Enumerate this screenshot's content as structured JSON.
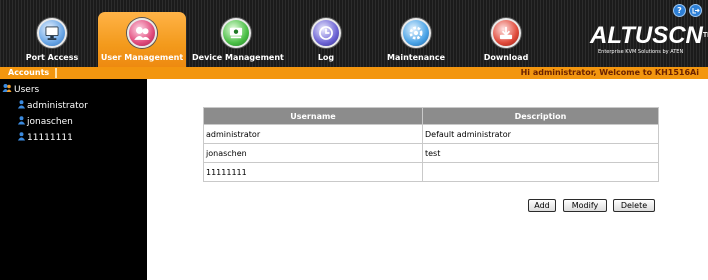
{
  "header": {
    "tabs": [
      {
        "label": "Port Access",
        "icon": "monitor-icon",
        "active": false
      },
      {
        "label": "User Management",
        "icon": "users-icon",
        "active": true
      },
      {
        "label": "Device Management",
        "icon": "device-icon",
        "active": false
      },
      {
        "label": "Log",
        "icon": "log-icon",
        "active": false
      },
      {
        "label": "Maintenance",
        "icon": "maintenance-icon",
        "active": false
      },
      {
        "label": "Download",
        "icon": "download-icon",
        "active": false
      }
    ],
    "help_icon": "?",
    "logout_icon": "logout-icon",
    "logo": {
      "brand": "ALTUSCN",
      "trademark": "TM",
      "tagline": "Enterprise KVM Solutions by ATEN"
    }
  },
  "subbar": {
    "section": "Accounts",
    "welcome": "Hi administrator, Welcome to KH1516Ai"
  },
  "sidebar": {
    "root": "Users",
    "users": [
      "administrator",
      "jonaschen",
      "11111111"
    ]
  },
  "table": {
    "headers": [
      "Username",
      "Description"
    ],
    "rows": [
      {
        "username": "administrator",
        "description": "Default administrator"
      },
      {
        "username": "jonaschen",
        "description": "test"
      },
      {
        "username": "11111111",
        "description": ""
      }
    ]
  },
  "buttons": {
    "add": "Add",
    "modify": "Modify",
    "delete": "Delete"
  },
  "colors": {
    "accent": "#f3960f",
    "header_bg": "#1b1b1b",
    "sidebar_bg": "#000000",
    "table_header": "#8c8c8c"
  }
}
